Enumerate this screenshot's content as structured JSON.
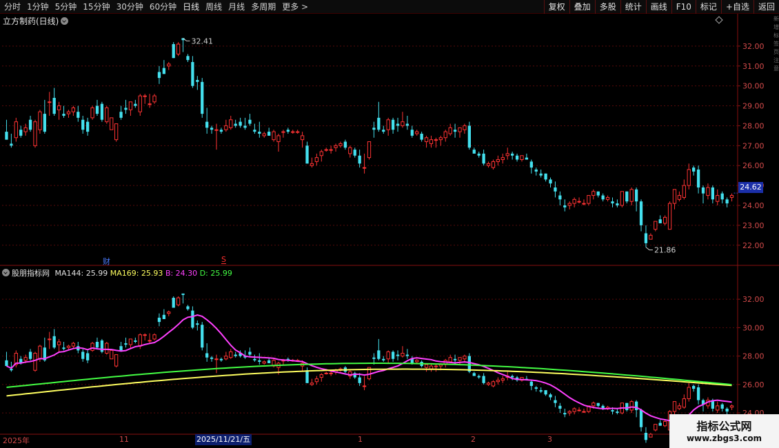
{
  "toolbar": {
    "periods": [
      "分时",
      "1分钟",
      "5分钟",
      "15分钟",
      "30分钟",
      "60分钟",
      "日线",
      "周线",
      "月线",
      "多周期",
      "更多 >"
    ],
    "tools": [
      "复权",
      "叠加",
      "多股",
      "统计",
      "画线",
      "F10",
      "标记",
      "+自选",
      "返回"
    ]
  },
  "stock": {
    "title": "立方制药(日线)"
  },
  "price_tag": "24.62",
  "high_label": "32.41",
  "low_label": "21.86",
  "events": {
    "cai": "财",
    "s": "S"
  },
  "indicator": {
    "name": "股朋指标网",
    "ma144": "MA144: 25.99",
    "ma169": "MA169: 25.93",
    "b": "B: 24.30",
    "d": "D: 25.99"
  },
  "right_strip": "新增标签页注意",
  "date_bar": {
    "labels": [
      "2025年",
      "11",
      "1",
      "2",
      "3"
    ],
    "cursor": "2025/11/21/五"
  },
  "watermark": {
    "title": "指标公式网",
    "url": "www.zbgs3.com"
  },
  "colors": {
    "up": "#ff3333",
    "down": "#44e0ee",
    "bg": "#000000",
    "grid": "#5a0a0a",
    "ma144": "#44ff44",
    "ma169": "#ffff60",
    "b": "#ff40ff"
  },
  "chart_data": {
    "type": "candlestick",
    "price_axis": {
      "ticks": [
        22,
        23,
        24,
        25,
        26,
        27,
        28,
        29,
        30,
        31,
        32
      ],
      "range": [
        21.3,
        33.0
      ]
    },
    "indicator_axis": {
      "ticks": [
        24,
        26,
        28,
        30,
        32
      ],
      "range": [
        22.6,
        33.8
      ]
    },
    "ohlc": [
      [
        27.7,
        28.3,
        27.3,
        27.3
      ],
      [
        27.1,
        27.6,
        26.9,
        27.0
      ],
      [
        27.4,
        28.4,
        27.2,
        28.2
      ],
      [
        27.8,
        28.0,
        27.4,
        27.5
      ],
      [
        27.7,
        28.1,
        27.5,
        27.9
      ],
      [
        28.3,
        28.5,
        27.7,
        27.8
      ],
      [
        27.0,
        28.3,
        26.9,
        28.2
      ],
      [
        27.8,
        28.8,
        27.6,
        28.7
      ],
      [
        28.6,
        29.3,
        27.6,
        27.7
      ],
      [
        29.2,
        29.7,
        28.5,
        29.2
      ],
      [
        29.4,
        29.9,
        28.5,
        28.6
      ],
      [
        28.8,
        29.2,
        28.3,
        29.0
      ],
      [
        28.6,
        29.0,
        28.4,
        28.5
      ],
      [
        28.6,
        28.8,
        28.4,
        28.7
      ],
      [
        28.7,
        29.0,
        28.5,
        28.9
      ],
      [
        28.7,
        29.0,
        28.2,
        28.4
      ],
      [
        28.3,
        28.5,
        27.6,
        27.8
      ],
      [
        28.2,
        28.4,
        27.5,
        27.7
      ],
      [
        28.4,
        29.0,
        28.3,
        28.9
      ],
      [
        29.0,
        29.3,
        28.5,
        28.6
      ],
      [
        29.1,
        29.2,
        28.2,
        28.3
      ],
      [
        28.2,
        29.0,
        28.1,
        28.9
      ],
      [
        27.8,
        28.4,
        27.8,
        28.4
      ],
      [
        27.3,
        28.1,
        27.2,
        28.1
      ],
      [
        28.7,
        29.0,
        28.3,
        28.4
      ],
      [
        28.9,
        29.3,
        28.6,
        28.8
      ],
      [
        28.8,
        29.2,
        28.5,
        29.2
      ],
      [
        29.1,
        29.3,
        28.9,
        29.0
      ],
      [
        28.7,
        29.6,
        28.5,
        29.5
      ],
      [
        29.5,
        29.6,
        29.1,
        29.5
      ],
      [
        29.1,
        29.6,
        28.9,
        29.1
      ],
      [
        29.2,
        29.6,
        29.1,
        29.5
      ],
      [
        30.7,
        31.0,
        30.1,
        30.4
      ],
      [
        30.9,
        31.3,
        30.6,
        30.6
      ],
      [
        31.0,
        31.2,
        30.8,
        31.1
      ],
      [
        32.1,
        32.2,
        31.4,
        31.4
      ],
      [
        31.6,
        32.2,
        31.5,
        32.1
      ],
      [
        32.4,
        32.4,
        31.7,
        32.3
      ],
      [
        31.5,
        31.6,
        31.2,
        31.3
      ],
      [
        31.2,
        31.5,
        29.9,
        30.0
      ],
      [
        30.3,
        30.5,
        29.8,
        30.2
      ],
      [
        30.2,
        30.4,
        28.4,
        28.6
      ],
      [
        28.2,
        28.9,
        27.6,
        27.9
      ],
      [
        27.9,
        28.0,
        27.6,
        27.8
      ],
      [
        27.8,
        28.1,
        26.8,
        27.8
      ],
      [
        27.8,
        27.9,
        27.6,
        27.7
      ],
      [
        27.8,
        28.3,
        27.7,
        28.0
      ],
      [
        27.9,
        28.5,
        27.8,
        28.3
      ],
      [
        28.1,
        28.3,
        27.9,
        28.0
      ],
      [
        28.2,
        28.4,
        27.9,
        28.0
      ],
      [
        28.0,
        28.4,
        27.8,
        27.9
      ],
      [
        28.3,
        28.6,
        28.0,
        28.1
      ],
      [
        27.8,
        28.1,
        27.6,
        27.7
      ],
      [
        27.7,
        28.2,
        27.4,
        27.6
      ],
      [
        27.5,
        27.7,
        27.4,
        27.6
      ],
      [
        27.7,
        27.9,
        27.5,
        27.5
      ],
      [
        27.3,
        27.8,
        27.2,
        27.7
      ],
      [
        27.2,
        27.6,
        26.7,
        27.5
      ],
      [
        27.7,
        27.8,
        27.4,
        27.7
      ],
      [
        27.8,
        27.9,
        27.6,
        27.7
      ],
      [
        27.7,
        27.8,
        27.6,
        27.7
      ],
      [
        27.7,
        27.8,
        27.6,
        27.7
      ],
      [
        27.3,
        27.7,
        26.9,
        27.5
      ],
      [
        27.0,
        27.2,
        26.1,
        26.1
      ],
      [
        26.0,
        26.4,
        25.9,
        26.1
      ],
      [
        26.2,
        26.6,
        26.0,
        26.4
      ],
      [
        26.5,
        26.8,
        26.2,
        26.7
      ],
      [
        26.8,
        26.9,
        26.7,
        26.8
      ],
      [
        26.8,
        27.0,
        26.6,
        26.8
      ],
      [
        26.9,
        27.1,
        26.7,
        27.0
      ],
      [
        27.0,
        27.2,
        26.9,
        27.1
      ],
      [
        27.2,
        27.3,
        26.8,
        26.9
      ],
      [
        26.6,
        27.0,
        26.4,
        26.9
      ],
      [
        26.8,
        26.9,
        26.4,
        26.5
      ],
      [
        26.5,
        26.8,
        25.9,
        26.1
      ],
      [
        25.9,
        26.6,
        25.6,
        25.9
      ],
      [
        26.4,
        27.2,
        26.3,
        27.2
      ],
      [
        27.9,
        28.2,
        27.4,
        27.8
      ],
      [
        28.4,
        29.2,
        27.7,
        27.8
      ],
      [
        27.8,
        28.0,
        27.6,
        27.7
      ],
      [
        27.8,
        28.4,
        27.5,
        28.3
      ],
      [
        28.3,
        28.4,
        27.6,
        27.8
      ],
      [
        28.1,
        28.4,
        27.7,
        28.0
      ],
      [
        28.0,
        28.7,
        27.9,
        28.2
      ],
      [
        28.1,
        28.5,
        27.8,
        28.0
      ],
      [
        27.8,
        28.0,
        27.4,
        27.5
      ],
      [
        27.6,
        27.8,
        27.5,
        27.7
      ],
      [
        27.6,
        27.7,
        27.2,
        27.3
      ],
      [
        27.2,
        27.5,
        26.9,
        27.4
      ],
      [
        27.1,
        27.5,
        26.9,
        27.3
      ],
      [
        27.3,
        27.4,
        26.9,
        27.3
      ],
      [
        27.3,
        27.5,
        27.0,
        27.4
      ],
      [
        27.4,
        27.8,
        27.2,
        27.7
      ],
      [
        27.6,
        28.1,
        27.5,
        27.9
      ],
      [
        27.8,
        28.1,
        27.4,
        27.7
      ],
      [
        27.7,
        27.9,
        27.4,
        27.9
      ],
      [
        27.8,
        28.1,
        27.6,
        28.0
      ],
      [
        28.0,
        28.2,
        26.8,
        26.9
      ],
      [
        26.8,
        26.9,
        26.6,
        26.6
      ],
      [
        26.6,
        26.7,
        26.4,
        26.5
      ],
      [
        26.6,
        26.8,
        26.0,
        26.1
      ],
      [
        26.0,
        26.2,
        25.9,
        26.1
      ],
      [
        25.9,
        26.3,
        25.8,
        26.2
      ],
      [
        26.2,
        26.5,
        26.0,
        26.3
      ],
      [
        26.3,
        26.6,
        26.1,
        26.4
      ],
      [
        26.5,
        26.9,
        26.3,
        26.6
      ],
      [
        26.6,
        26.7,
        26.3,
        26.5
      ],
      [
        26.5,
        26.6,
        26.2,
        26.3
      ],
      [
        26.3,
        26.5,
        26.2,
        26.5
      ],
      [
        26.4,
        26.6,
        26.3,
        26.3
      ],
      [
        26.2,
        26.3,
        25.6,
        25.9
      ],
      [
        25.8,
        25.9,
        25.5,
        25.7
      ],
      [
        25.6,
        25.8,
        25.4,
        25.5
      ],
      [
        25.6,
        25.6,
        25.2,
        25.3
      ],
      [
        25.3,
        25.4,
        24.9,
        25.1
      ],
      [
        24.9,
        25.2,
        24.4,
        24.7
      ],
      [
        24.5,
        24.7,
        24.0,
        24.3
      ],
      [
        24.0,
        24.3,
        23.7,
        23.9
      ],
      [
        24.0,
        24.2,
        23.8,
        24.1
      ],
      [
        24.1,
        24.4,
        23.9,
        24.3
      ],
      [
        24.2,
        24.4,
        24.1,
        24.2
      ],
      [
        24.1,
        24.3,
        24.0,
        24.1
      ],
      [
        24.1,
        24.5,
        24.0,
        24.5
      ],
      [
        24.5,
        24.8,
        24.3,
        24.7
      ],
      [
        24.7,
        24.7,
        24.4,
        24.5
      ],
      [
        24.5,
        24.6,
        24.2,
        24.3
      ],
      [
        24.3,
        24.5,
        24.2,
        24.4
      ],
      [
        24.2,
        24.4,
        23.9,
        24.1
      ],
      [
        24.1,
        24.3,
        23.9,
        24.0
      ],
      [
        24.0,
        24.7,
        23.9,
        24.7
      ],
      [
        24.7,
        24.7,
        24.1,
        24.2
      ],
      [
        24.2,
        24.9,
        24.0,
        24.8
      ],
      [
        24.8,
        24.9,
        23.7,
        24.2
      ],
      [
        24.2,
        24.3,
        22.7,
        23.0
      ],
      [
        22.6,
        23.0,
        21.9,
        22.1
      ],
      [
        22.3,
        22.6,
        22.3,
        22.5
      ],
      [
        22.8,
        23.2,
        22.7,
        23.2
      ],
      [
        23.3,
        23.5,
        23.1,
        23.1
      ],
      [
        23.1,
        23.5,
        23.0,
        23.4
      ],
      [
        22.8,
        24.2,
        22.8,
        24.1
      ],
      [
        24.1,
        24.8,
        23.8,
        24.8
      ],
      [
        24.3,
        24.7,
        24.2,
        24.5
      ],
      [
        24.4,
        25.3,
        24.3,
        25.0
      ],
      [
        25.0,
        26.1,
        24.8,
        25.8
      ],
      [
        25.9,
        26.0,
        25.5,
        25.7
      ],
      [
        25.8,
        26.0,
        24.6,
        24.9
      ],
      [
        24.9,
        25.0,
        24.1,
        24.6
      ],
      [
        24.5,
        25.1,
        24.3,
        24.9
      ],
      [
        24.9,
        25.0,
        24.1,
        24.3
      ],
      [
        24.2,
        24.8,
        24.0,
        24.5
      ],
      [
        24.6,
        24.7,
        24.1,
        24.3
      ],
      [
        24.3,
        24.4,
        23.9,
        24.1
      ],
      [
        24.4,
        24.6,
        24.2,
        24.5
      ]
    ],
    "ma144": {
      "from": 25.8,
      "to": 25.99
    },
    "ma169": {
      "from": 25.2,
      "to": 25.93
    },
    "current_price": 24.62,
    "high": 32.41,
    "low": 21.86
  }
}
